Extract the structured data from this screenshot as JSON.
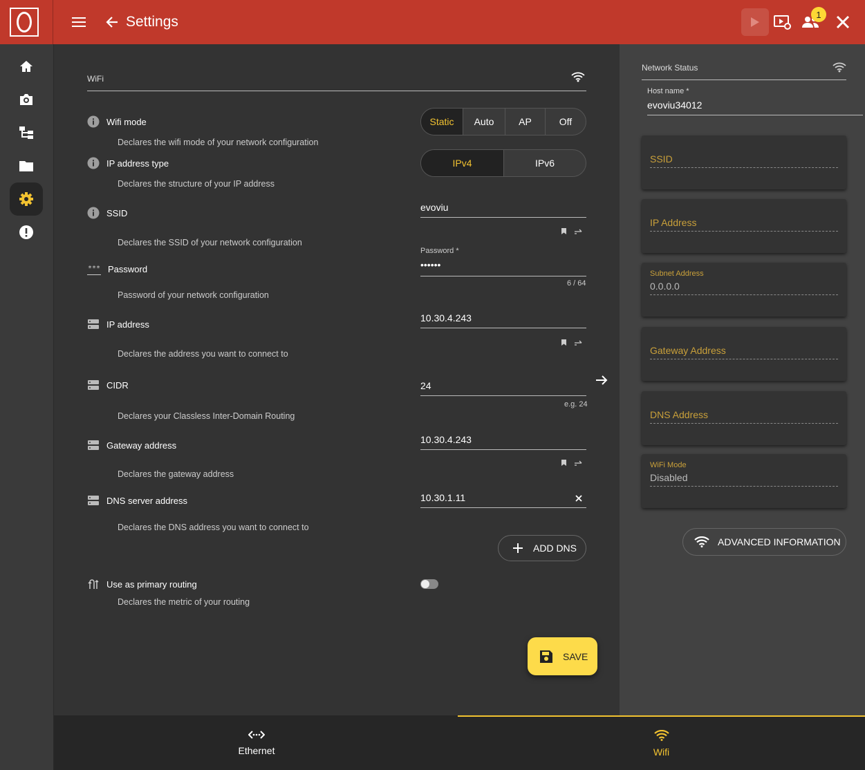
{
  "header": {
    "title": "Settings",
    "notification_count": "1"
  },
  "sidebar": {
    "items": [
      {
        "name": "home",
        "icon": "home-icon"
      },
      {
        "name": "camera",
        "icon": "camera-icon"
      },
      {
        "name": "hierarchy",
        "icon": "hierarchy-icon"
      },
      {
        "name": "folder",
        "icon": "folder-icon"
      },
      {
        "name": "settings",
        "icon": "gear-icon",
        "active": true
      },
      {
        "name": "alert",
        "icon": "alert-icon"
      }
    ]
  },
  "wifi": {
    "section_title": "WiFi",
    "mode": {
      "label": "Wifi mode",
      "desc": "Declares the wifi mode of your network configuration",
      "options": [
        "Static",
        "Auto",
        "AP",
        "Off"
      ],
      "selected": "Static"
    },
    "ip_type": {
      "label": "IP address type",
      "desc": "Declares the structure of your IP address",
      "options": [
        "IPv4",
        "IPv6"
      ],
      "selected": "IPv4"
    },
    "ssid": {
      "label": "SSID",
      "desc": "Declares the SSID of your network configuration",
      "value": "evoviu"
    },
    "password": {
      "label": "Password",
      "desc": "Password of your network configuration",
      "field_label": "Password *",
      "value": "••••••",
      "counter": "6 / 64",
      "icon_text": "***"
    },
    "ip_address": {
      "label": "IP address",
      "desc": "Declares the address you want to connect to",
      "value": "10.30.4.243"
    },
    "cidr": {
      "label": "CIDR",
      "desc": "Declares your Classless Inter-Domain Routing",
      "value": "24",
      "hint": "e.g. 24"
    },
    "gateway": {
      "label": "Gateway address",
      "desc": "Declares the gateway address",
      "value": "10.30.4.243"
    },
    "dns": {
      "label": "DNS server address",
      "desc": "Declares the DNS address you want to connect to",
      "value": "10.30.1.11"
    },
    "add_dns_label": "ADD DNS",
    "primary_routing": {
      "label": "Use as primary routing",
      "desc": "Declares the metric of your routing",
      "enabled": false
    },
    "save_label": "SAVE"
  },
  "network_status": {
    "title": "Network Status",
    "host_label": "Host name *",
    "host_value": "evoviu34012",
    "ssid_label": "SSID",
    "ip_label": "IP Address",
    "subnet_label": "Subnet Address",
    "subnet_value": "0.0.0.0",
    "gateway_label": "Gateway Address",
    "dns_label": "DNS Address",
    "wifi_mode_label": "WiFi Mode",
    "wifi_mode_value": "Disabled",
    "advanced_label": "ADVANCED INFORMATION"
  },
  "bottom_tabs": [
    {
      "label": "Ethernet",
      "icon": "ethernet-icon",
      "active": false
    },
    {
      "label": "Wifi",
      "icon": "wifi-icon",
      "active": true
    }
  ],
  "colors": {
    "topbar": "#c0392b",
    "accent": "#f2c230",
    "save": "#fddb4a"
  }
}
